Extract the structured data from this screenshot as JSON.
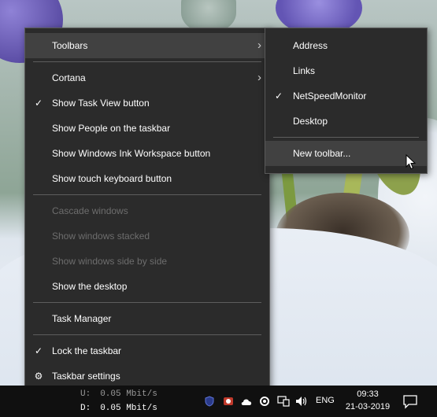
{
  "context_menu": {
    "items": [
      {
        "label": "Toolbars",
        "submenu": true,
        "highlight": true
      },
      {
        "label": "Cortana",
        "submenu": true
      },
      {
        "label": "Show Task View button",
        "checked": true
      },
      {
        "label": "Show People on the taskbar"
      },
      {
        "label": "Show Windows Ink Workspace button"
      },
      {
        "label": "Show touch keyboard button"
      },
      {
        "label": "Cascade windows",
        "disabled": true
      },
      {
        "label": "Show windows stacked",
        "disabled": true
      },
      {
        "label": "Show windows side by side",
        "disabled": true
      },
      {
        "label": "Show the desktop"
      },
      {
        "label": "Task Manager"
      },
      {
        "label": "Lock the taskbar",
        "checked": true
      },
      {
        "label": "Taskbar settings",
        "icon": "gear-icon"
      }
    ]
  },
  "toolbars_submenu": {
    "items": [
      {
        "label": "Address"
      },
      {
        "label": "Links"
      },
      {
        "label": "NetSpeedMonitor",
        "checked": true
      },
      {
        "label": "Desktop"
      },
      {
        "label": "New toolbar...",
        "highlight": true
      }
    ]
  },
  "taskbar": {
    "netspeed": {
      "upload_label": "U:",
      "upload_value": "0.05 Mbit/s",
      "download_label": "D:",
      "download_value": "0.05 Mbit/s"
    },
    "language": "ENG",
    "time": "09:33",
    "date": "21-03-2019",
    "tray_icons": [
      "shield-icon",
      "cloud-icon",
      "sync-icon",
      "onedrive-icon",
      "network-icon",
      "volume-icon"
    ]
  },
  "colors": {
    "menu_bg": "#2b2b2b",
    "menu_highlight": "#414141",
    "disabled_text": "#6d6d6d",
    "taskbar_bg": "#101010"
  }
}
